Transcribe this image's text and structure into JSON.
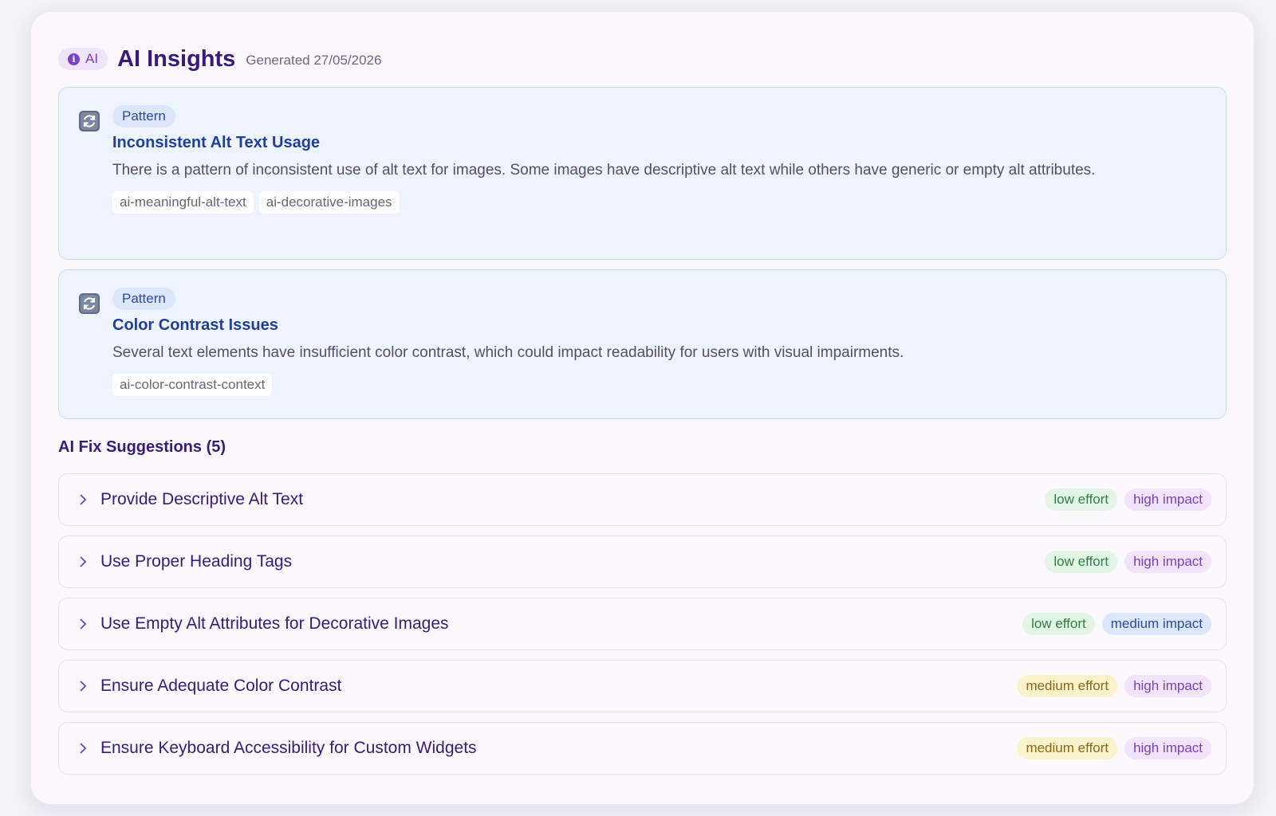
{
  "header": {
    "ai_badge": "AI",
    "title": "AI Insights",
    "generated": "Generated 27/05/2026"
  },
  "insights": [
    {
      "type": "Pattern",
      "icon": "refresh-icon",
      "title": "Inconsistent Alt Text Usage",
      "description": "There is a pattern of inconsistent use of alt text for images. Some images have descriptive alt text while others have generic or empty alt attributes.",
      "tags": [
        "ai-meaningful-alt-text",
        "ai-decorative-images"
      ]
    },
    {
      "type": "Pattern",
      "icon": "refresh-icon",
      "title": "Color Contrast Issues",
      "description": "Several text elements have insufficient color contrast, which could impact readability for users with visual impairments.",
      "tags": [
        "ai-color-contrast-context"
      ]
    }
  ],
  "suggestions_title": "AI Fix Suggestions (5)",
  "suggestions": [
    {
      "title": "Provide Descriptive Alt Text",
      "effort": "low effort",
      "impact": "high impact"
    },
    {
      "title": "Use Proper Heading Tags",
      "effort": "low effort",
      "impact": "high impact"
    },
    {
      "title": "Use Empty Alt Attributes for Decorative Images",
      "effort": "low effort",
      "impact": "medium impact"
    },
    {
      "title": "Ensure Adequate Color Contrast",
      "effort": "medium effort",
      "impact": "high impact"
    },
    {
      "title": "Ensure Keyboard Accessibility for Custom Widgets",
      "effort": "medium effort",
      "impact": "high impact"
    }
  ],
  "colors": {
    "accent": "#7b3fc4",
    "title": "#3a1a78",
    "insight_bg": "#eef4fe",
    "low_effort": "#2f7f45",
    "medium_effort": "#8a6716",
    "high_impact": "#7b3fc4",
    "medium_impact": "#2c4aa0"
  }
}
